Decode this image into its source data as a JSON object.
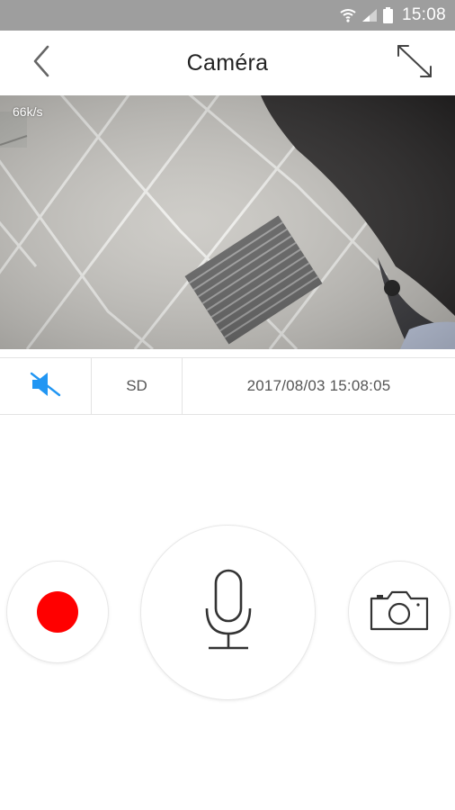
{
  "status_bar": {
    "time": "15:08",
    "icons": [
      "wifi-icon",
      "signal-icon",
      "battery-icon"
    ]
  },
  "header": {
    "title": "Caméra",
    "back_icon": "chevron-left-icon",
    "fullscreen_icon": "expand-icon"
  },
  "video": {
    "bitrate": "66k/s"
  },
  "controls": {
    "mute_icon": "speaker-muted-icon",
    "quality": "SD",
    "timestamp": "2017/08/03 15:08:05",
    "accent": "#2196f3"
  },
  "actions": {
    "record_icon": "record-icon",
    "record_color": "#ff0000",
    "talk_icon": "microphone-icon",
    "snapshot_icon": "camera-icon"
  }
}
